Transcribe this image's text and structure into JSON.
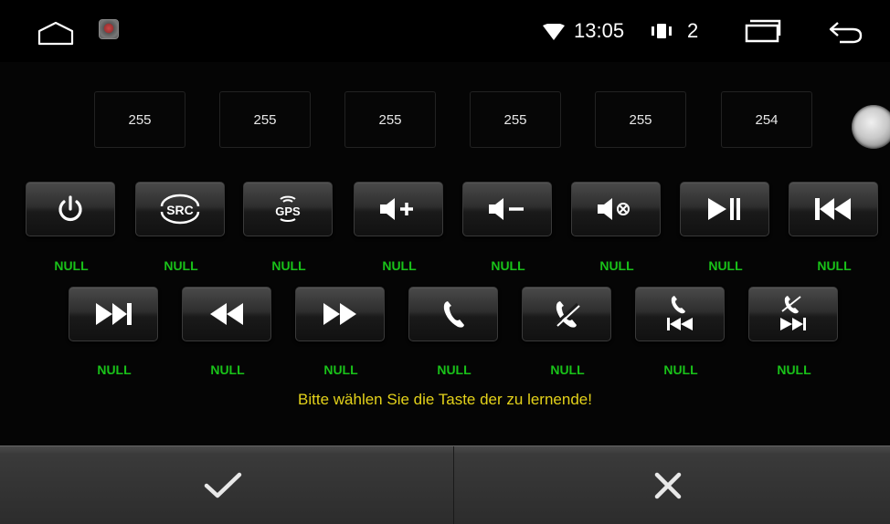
{
  "status_bar": {
    "time": "13:05",
    "volume_level": "2",
    "icons": [
      "home-icon",
      "app-icon",
      "wifi-icon",
      "vibrate-icon",
      "recents-icon",
      "back-icon"
    ]
  },
  "values": [
    "255",
    "255",
    "255",
    "255",
    "255",
    "254"
  ],
  "keys_row1": [
    {
      "icon": "power-icon",
      "label": "NULL"
    },
    {
      "icon": "src-icon",
      "icon_text": "SRC",
      "label": "NULL"
    },
    {
      "icon": "gps-icon",
      "icon_text": "GPS",
      "label": "NULL"
    },
    {
      "icon": "volume-up-icon",
      "label": "NULL"
    },
    {
      "icon": "volume-down-icon",
      "label": "NULL"
    },
    {
      "icon": "mute-icon",
      "label": "NULL"
    },
    {
      "icon": "play-pause-icon",
      "label": "NULL"
    },
    {
      "icon": "previous-track-icon",
      "label": "NULL"
    }
  ],
  "keys_row2": [
    {
      "icon": "next-track-icon",
      "label": "NULL"
    },
    {
      "icon": "rewind-icon",
      "label": "NULL"
    },
    {
      "icon": "fast-forward-icon",
      "label": "NULL"
    },
    {
      "icon": "phone-answer-icon",
      "label": "NULL"
    },
    {
      "icon": "phone-hangup-icon",
      "label": "NULL"
    },
    {
      "icon": "phone-previous-icon",
      "label": "NULL"
    },
    {
      "icon": "phone-next-icon",
      "label": "NULL"
    }
  ],
  "instruction": "Bitte wählen Sie die Taste der zu lernende!",
  "bottom_bar": {
    "confirm_icon": "checkmark-icon",
    "cancel_icon": "close-icon"
  },
  "colors": {
    "null_label": "#19c219",
    "instruction": "#e4d21a",
    "background": "#050505"
  }
}
